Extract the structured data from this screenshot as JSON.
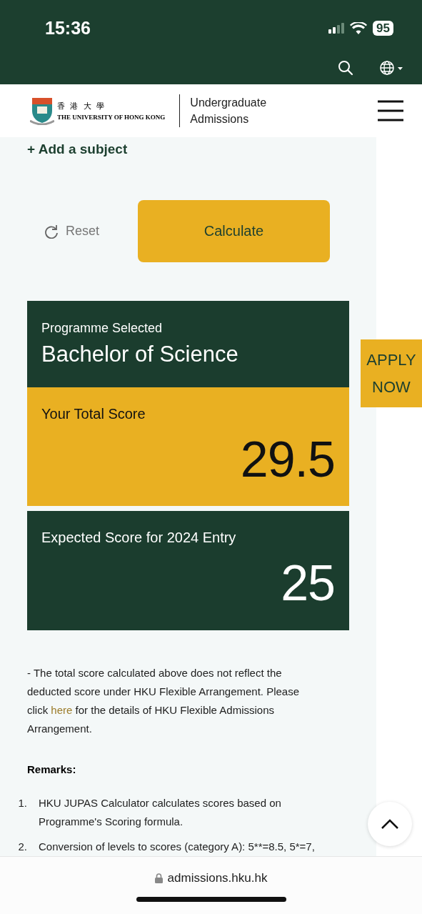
{
  "status_bar": {
    "time": "15:36",
    "battery": "95"
  },
  "header": {
    "logo_chinese": "香 港 大 學",
    "logo_english": "THE UNIVERSITY OF HONG KONG",
    "site_title_line1": "Undergraduate",
    "site_title_line2": "Admissions"
  },
  "add_subject": "+ Add a subject",
  "reset_label": "Reset",
  "calculate_label": "Calculate",
  "programme": {
    "label": "Programme Selected",
    "name": "Bachelor of Science"
  },
  "total_score": {
    "label": "Your Total Score",
    "value": "29.5"
  },
  "expected_score": {
    "label": "Expected Score for 2024 Entry",
    "value": "25"
  },
  "note": {
    "before": "- The total score calculated above does not reflect the deducted score under HKU Flexible Arrangement. Please click",
    "link": "here",
    "after": "for the details of HKU Flexible Admissions Arrangement."
  },
  "remarks_title": "Remarks:",
  "remarks": [
    {
      "number": "1.",
      "text": "HKU JUPAS Calculator calculates scores based on Programme's Scoring formula."
    },
    {
      "number": "2.",
      "text": "Conversion of levels to scores (category A): 5**=8.5, 5*=7,"
    }
  ],
  "apply_now": "APPLY NOW",
  "url": "admissions.hku.hk"
}
